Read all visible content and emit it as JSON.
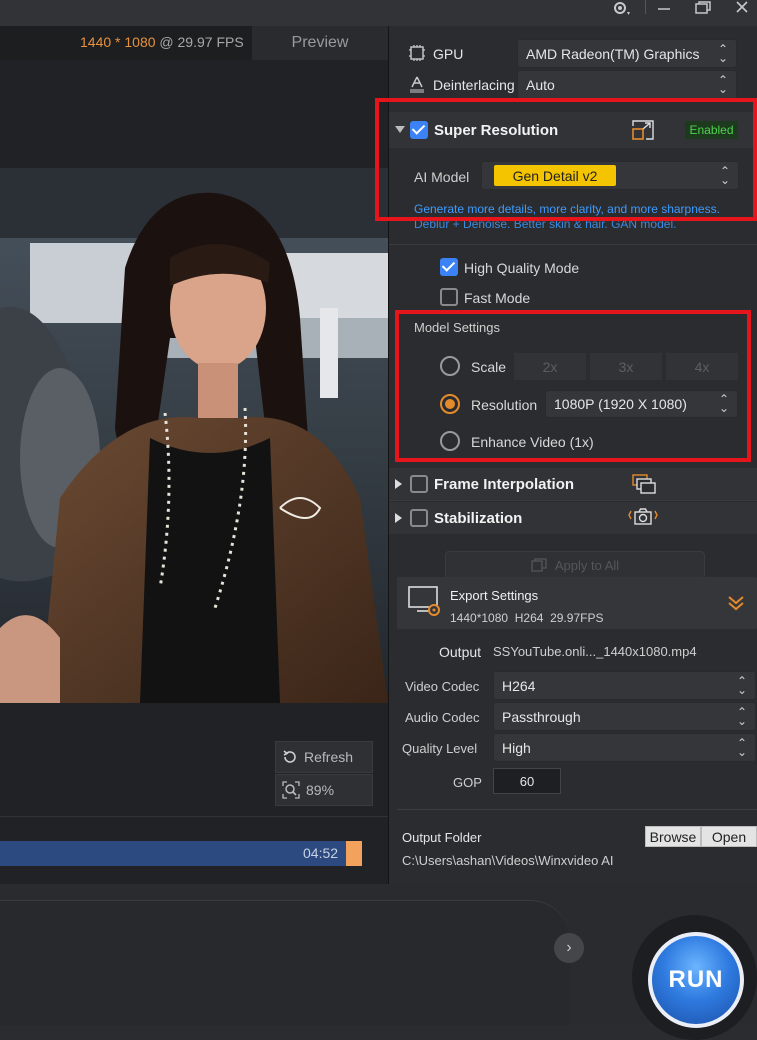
{
  "preview": {
    "resolution_text": "1440 * 1080",
    "fps_text": "@ 29.97 FPS",
    "tab_label": "Preview",
    "refresh_label": "Refresh",
    "zoom_label": "89%",
    "time": "04:52"
  },
  "settings": {
    "gpu_label": "GPU",
    "gpu_value": "AMD Radeon(TM) Graphics",
    "deinterlacing_label": "Deinterlacing",
    "deinterlacing_value": "Auto"
  },
  "super_resolution": {
    "title": "Super Resolution",
    "status": "Enabled",
    "ai_model_label": "AI Model",
    "ai_model_value": "Gen Detail v2",
    "desc1": "Generate more details, more clarity, and more sharpness.",
    "desc2": "Deblur + Denoise. Better skin & hair. GAN model.",
    "hq_mode": "High Quality Mode",
    "fast_mode": "Fast Mode",
    "model_settings": "Model Settings",
    "scale_label": "Scale",
    "scale_options": [
      "2x",
      "3x",
      "4x"
    ],
    "resolution_label": "Resolution",
    "resolution_value": "1080P (1920 X 1080)",
    "enhance_label": "Enhance Video (1x)"
  },
  "frame_interpolation": {
    "title": "Frame Interpolation"
  },
  "stabilization": {
    "title": "Stabilization"
  },
  "apply_all": "Apply to All",
  "export": {
    "title": "Export Settings",
    "summary": "1440*1080  H264  29.97FPS",
    "output_label": "Output",
    "output_value": "SSYouTube.onli..._1440x1080.mp4",
    "video_codec_label": "Video Codec",
    "video_codec_value": "H264",
    "audio_codec_label": "Audio Codec",
    "audio_codec_value": "Passthrough",
    "quality_label": "Quality Level",
    "quality_value": "High",
    "gop_label": "GOP",
    "gop_value": "60",
    "folder_label": "Output Folder",
    "folder_path": "C:\\Users\\ashan\\Videos\\Winxvideo AI",
    "browse_label": "Browse",
    "open_label": "Open"
  },
  "run_label": "RUN",
  "colors": {
    "accent_orange": "#e38b2c",
    "accent_blue": "#3b82f6",
    "highlight_red": "#e6141b",
    "yellow_chip": "#f5c400"
  }
}
